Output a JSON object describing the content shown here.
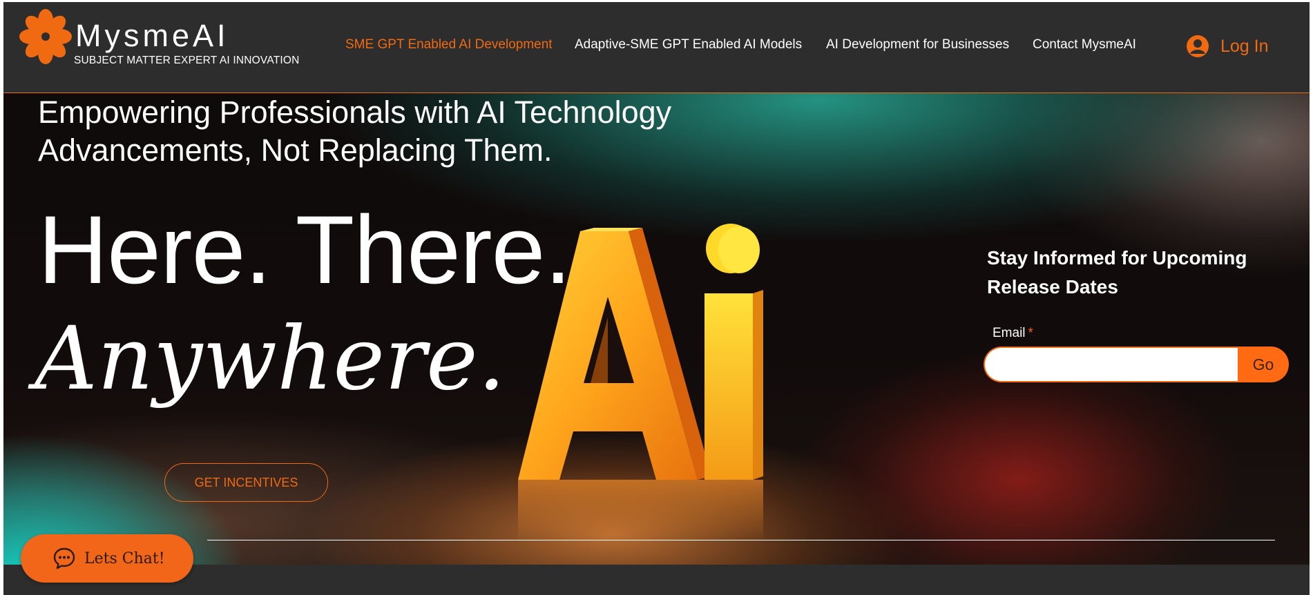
{
  "brand": {
    "name": "MysmeAI",
    "tagline": "SUBJECT MATTER EXPERT AI INNOVATION",
    "logo_icon": "orange-flower-icon"
  },
  "nav": {
    "items": [
      {
        "label": "SME GPT Enabled AI Development",
        "active": true
      },
      {
        "label": "Adaptive-SME GPT Enabled AI Models",
        "active": false
      },
      {
        "label": "AI Development for Businesses",
        "active": false
      },
      {
        "label": "Contact MysmeAI",
        "active": false
      }
    ],
    "login_label": "Log In",
    "login_icon": "user-circle-icon"
  },
  "hero": {
    "subheadline": "Empowering Professionals with AI Technology Advancements, Not Replacing Them.",
    "headline": "Here. There.",
    "script_headline": "Anywhere.",
    "cta_label": "GET INCENTIVES"
  },
  "signup": {
    "title": "Stay Informed for Upcoming Release Dates",
    "email_label": "Email",
    "required_marker": "*",
    "email_value": "",
    "go_label": "Go"
  },
  "chat": {
    "label": "Lets Chat!",
    "icon": "chat-bubble-icon"
  },
  "colors": {
    "accent": "#f06a12",
    "header_bg": "#2e2d2e",
    "go_button": "#ff6a13",
    "text": "#ffffff"
  }
}
